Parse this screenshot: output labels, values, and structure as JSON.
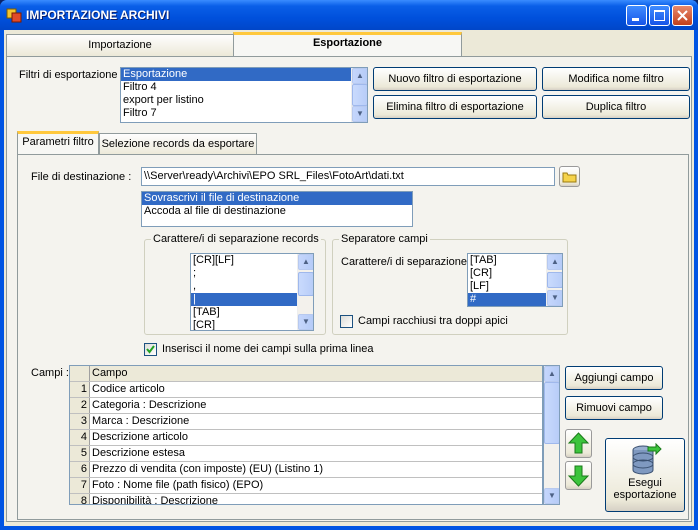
{
  "window": {
    "title": "IMPORTAZIONE ARCHIVI"
  },
  "tabs": [
    {
      "label": "Importazione"
    },
    {
      "label": "Esportazione"
    }
  ],
  "filters": {
    "label": "Filtri di esportazione :",
    "items": [
      "Esportazione",
      "Filtro 4",
      "export per listino",
      "Filtro 7"
    ],
    "selected": 0,
    "new_button": "Nuovo filtro di esportazione",
    "rename_button": "Modifica nome filtro",
    "delete_button": "Elimina filtro di esportazione",
    "duplicate_button": "Duplica filtro"
  },
  "subtabs": [
    {
      "label": "Parametri filtro"
    },
    {
      "label": "Selezione records da esportare"
    }
  ],
  "destination": {
    "label": "File di destinazione :",
    "value": "\\\\Server\\ready\\Archivi\\EPO SRL_Files\\FotoArt\\dati.txt",
    "modes": [
      "Sovrascrivi il file di destinazione",
      "Accoda al file di destinazione"
    ],
    "mode_selected": 0
  },
  "record_separator": {
    "title": "Carattere/i di separazione records",
    "items": [
      "[CR][LF]",
      ";",
      ",",
      "|",
      "[TAB]",
      "[CR]"
    ],
    "selected": 3
  },
  "field_separator": {
    "title": "Separatore campi",
    "label": "Carattere/i di separazione",
    "items": [
      "[TAB]",
      "[CR]",
      "[LF]",
      "#"
    ],
    "selected": 3,
    "quotes_label": "Campi racchiusi tra doppi apici",
    "quotes_checked": false
  },
  "header_line": {
    "label": "Inserisci il nome dei campi sulla prima linea",
    "checked": true
  },
  "fields": {
    "label": "Campi :",
    "header": "Campo",
    "rows": [
      {
        "n": "1",
        "name": "Codice articolo"
      },
      {
        "n": "2",
        "name": "Categoria : Descrizione"
      },
      {
        "n": "3",
        "name": "Marca : Descrizione"
      },
      {
        "n": "4",
        "name": "Descrizione articolo"
      },
      {
        "n": "5",
        "name": "Descrizione estesa"
      },
      {
        "n": "6",
        "name": "Prezzo di vendita (con imposte) (EU) (Listino 1)"
      },
      {
        "n": "7",
        "name": "Foto : Nome file (path fisico) (EPO)"
      },
      {
        "n": "8",
        "name": "Disponibilità : Descrizione"
      }
    ],
    "add_button": "Aggiungi campo",
    "remove_button": "Rimuovi campo",
    "execute_line1": "Esegui",
    "execute_line2": "esportazione"
  }
}
